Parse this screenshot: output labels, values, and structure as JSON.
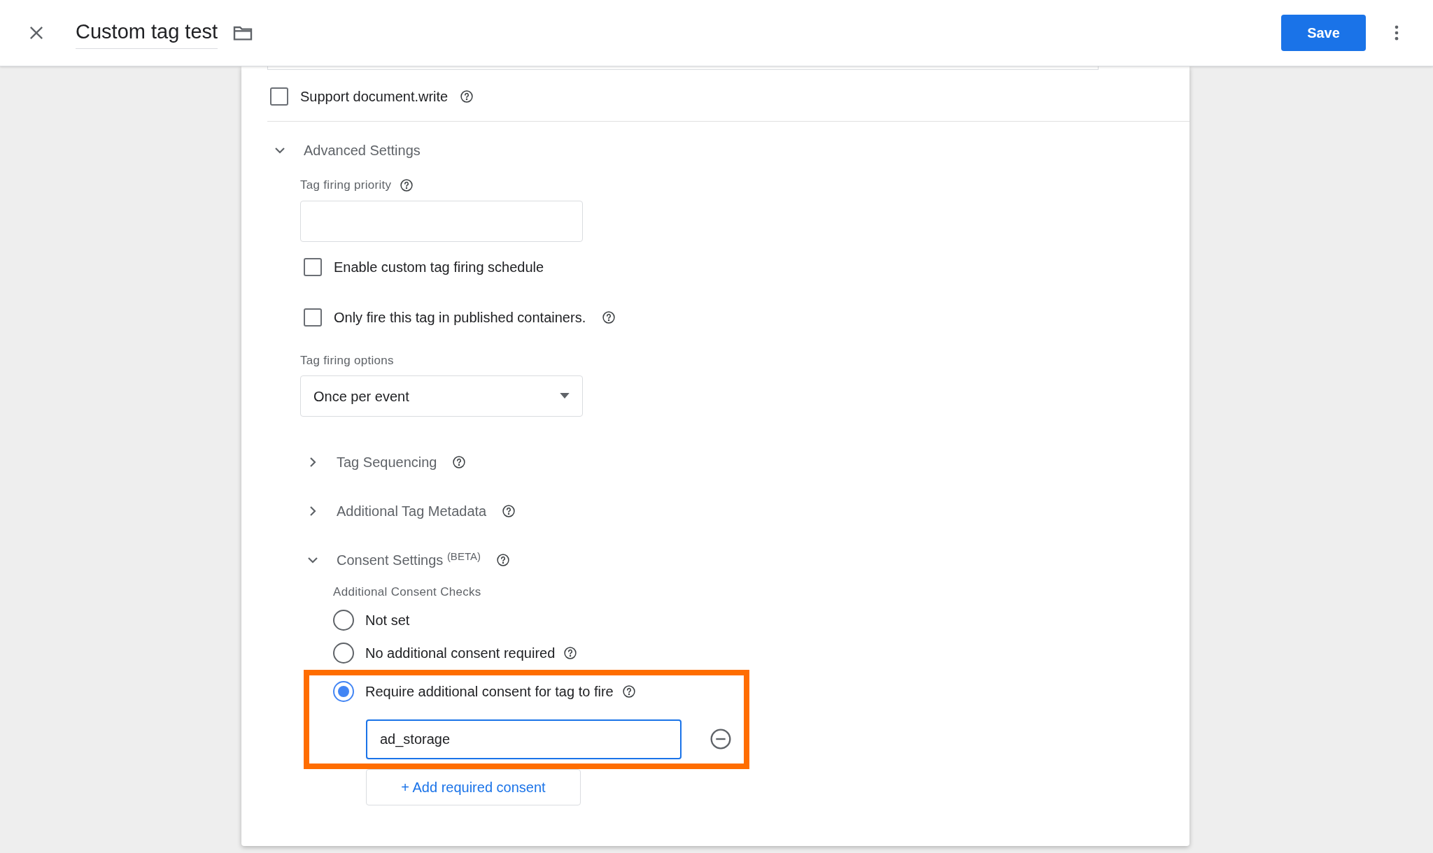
{
  "header": {
    "title": "Custom tag test",
    "save_label": "Save"
  },
  "support_document_write": {
    "label": "Support document.write",
    "checked": false
  },
  "advanced_settings": {
    "title": "Advanced Settings",
    "expanded": true,
    "priority": {
      "label": "Tag firing priority"
    },
    "checkboxes": [
      {
        "label": "Enable custom tag firing schedule",
        "checked": false,
        "help": false
      },
      {
        "label": "Only fire this tag in published containers.",
        "checked": false,
        "help": true
      }
    ],
    "firing_options": {
      "label": "Tag firing options",
      "value": "Once per event"
    }
  },
  "sections": [
    {
      "title": "Tag Sequencing",
      "expanded": false
    },
    {
      "title": "Additional Tag Metadata",
      "expanded": false
    },
    {
      "title": "Consent Settings $^{(BETA)}$",
      "expanded": true
    }
  ],
  "consent": {
    "label": "Additional Consent Checks",
    "options": [
      {
        "label": "Not set",
        "selected": false,
        "help": false
      },
      {
        "label": "No additional consent required",
        "selected": false,
        "help": true
      },
      {
        "label": "Require additional consent for tag to fire",
        "selected": true,
        "help": true
      }
    ],
    "required": [
      {
        "value": "ad_storage"
      }
    ],
    "add_label": "+ Add required consent"
  }
}
